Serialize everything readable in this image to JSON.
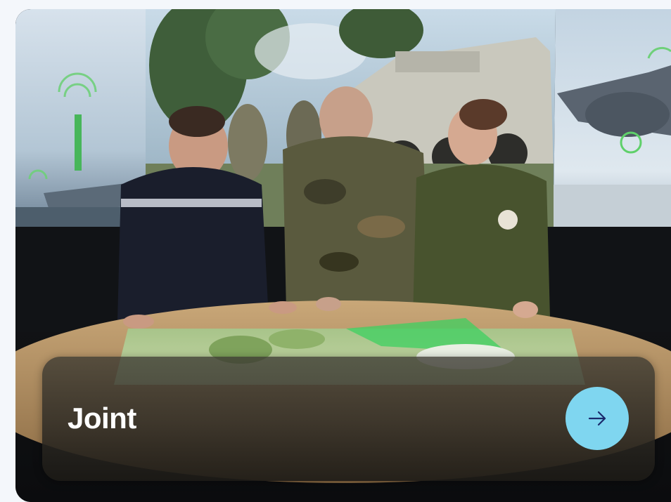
{
  "card": {
    "title": "Joint",
    "image_description_icon": "photo",
    "action_icon": "arrow-right-icon",
    "accent_color": "#7fd6f0",
    "arrow_color": "#1a2a6c"
  }
}
